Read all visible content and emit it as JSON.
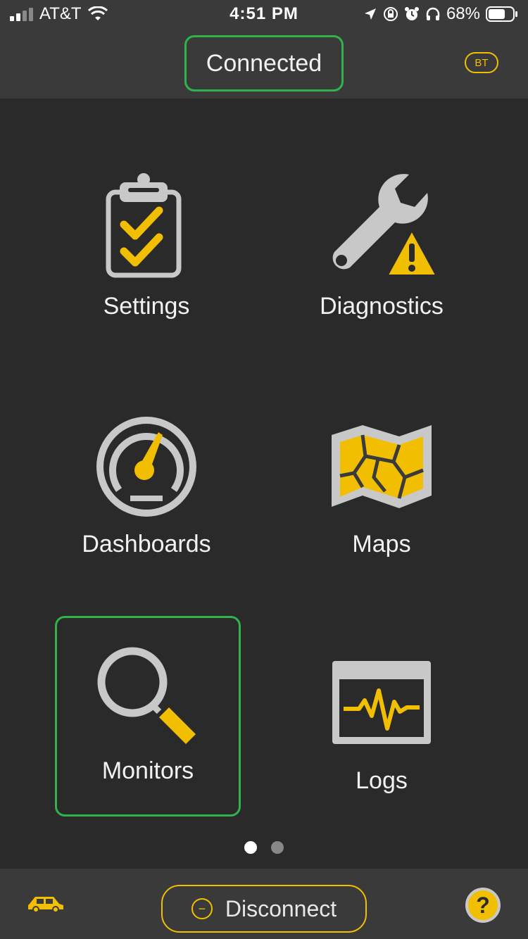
{
  "status_bar": {
    "carrier": "AT&T",
    "time": "4:51 PM",
    "battery": "68%"
  },
  "header": {
    "status": "Connected",
    "bt_badge": "BT"
  },
  "tiles": [
    {
      "label": "Settings",
      "icon": "clipboard-check-icon"
    },
    {
      "label": "Diagnostics",
      "icon": "wrench-warning-icon"
    },
    {
      "label": "Dashboards",
      "icon": "gauge-icon"
    },
    {
      "label": "Maps",
      "icon": "map-icon"
    },
    {
      "label": "Monitors",
      "icon": "magnifier-icon"
    },
    {
      "label": "Logs",
      "icon": "waveform-window-icon"
    }
  ],
  "pager": {
    "pages": 2,
    "active": 1
  },
  "footer": {
    "disconnect_label": "Disconnect",
    "disconnect_icon": "minus-circle-icon",
    "car_icon": "car-icon",
    "help_icon": "help-icon"
  },
  "colors": {
    "accent": "#f2bf00",
    "selection": "#2fb34a",
    "icon_gray": "#c8c8c8",
    "background": "#2a2a2a",
    "bar": "#3a3a3a"
  }
}
